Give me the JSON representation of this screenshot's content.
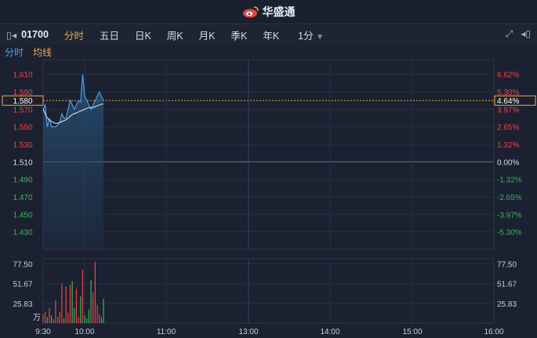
{
  "brand": {
    "name": "华盛通"
  },
  "toolbar": {
    "code": "01700",
    "tabs": [
      "分时",
      "五日",
      "日K",
      "周K",
      "月K",
      "季K",
      "年K"
    ],
    "interval": "1分"
  },
  "subtabs": {
    "time": "分时",
    "avg": "均线"
  },
  "colors": {
    "accent": "#f0a94a",
    "up": "#e8464a",
    "down": "#3fb35c",
    "price": "#4aa3f0",
    "avg": "#e8e8e8",
    "ref": "#f0a94a"
  },
  "chart_data": {
    "type": "line",
    "ref_price": 1.51,
    "current_price": "1.580",
    "current_pct": "4.64%",
    "price_axis": [
      "1.610",
      "1.590",
      "1.580",
      "1.570",
      "1.550",
      "1.530",
      "1.510",
      "1.490",
      "1.470",
      "1.450",
      "1.430"
    ],
    "pct_axis": [
      "6.62%",
      "5.30%",
      "4.64%",
      "3.97%",
      "2.65%",
      "1.32%",
      "0.00%",
      "-1.32%",
      "-2.65%",
      "-3.97%",
      "-5.30%"
    ],
    "ylim": [
      1.41,
      1.625
    ],
    "volume_axis": [
      "77.50",
      "51.67",
      "25.83"
    ],
    "volume_unit": "万",
    "x_ticks": [
      "9:30",
      "10:00",
      "11:00",
      "13:00",
      "14:00",
      "15:00",
      "16:00"
    ],
    "price": [
      1.57,
      1.575,
      1.55,
      1.56,
      1.55,
      1.55,
      1.55,
      1.552,
      1.555,
      1.565,
      1.56,
      1.56,
      1.57,
      1.58,
      1.575,
      1.57,
      1.575,
      1.58,
      1.578,
      1.61,
      1.585,
      1.58,
      1.575,
      1.57,
      1.575,
      1.58,
      1.585,
      1.59,
      1.585,
      1.58
    ],
    "avg": [
      1.57,
      1.565,
      1.56,
      1.558,
      1.556,
      1.555,
      1.554,
      1.554,
      1.555,
      1.556,
      1.557,
      1.558,
      1.56,
      1.562,
      1.564,
      1.565,
      1.566,
      1.567,
      1.568,
      1.569,
      1.57,
      1.571,
      1.572,
      1.572,
      1.572,
      1.573,
      1.574,
      1.575,
      1.576,
      1.576
    ],
    "volume": [
      12,
      15,
      8,
      20,
      10,
      5,
      30,
      8,
      15,
      52,
      6,
      48,
      14,
      50,
      55,
      20,
      45,
      8,
      35,
      70,
      10,
      6,
      18,
      56,
      40,
      80,
      24,
      12,
      8,
      32
    ],
    "volume_max": 80
  }
}
